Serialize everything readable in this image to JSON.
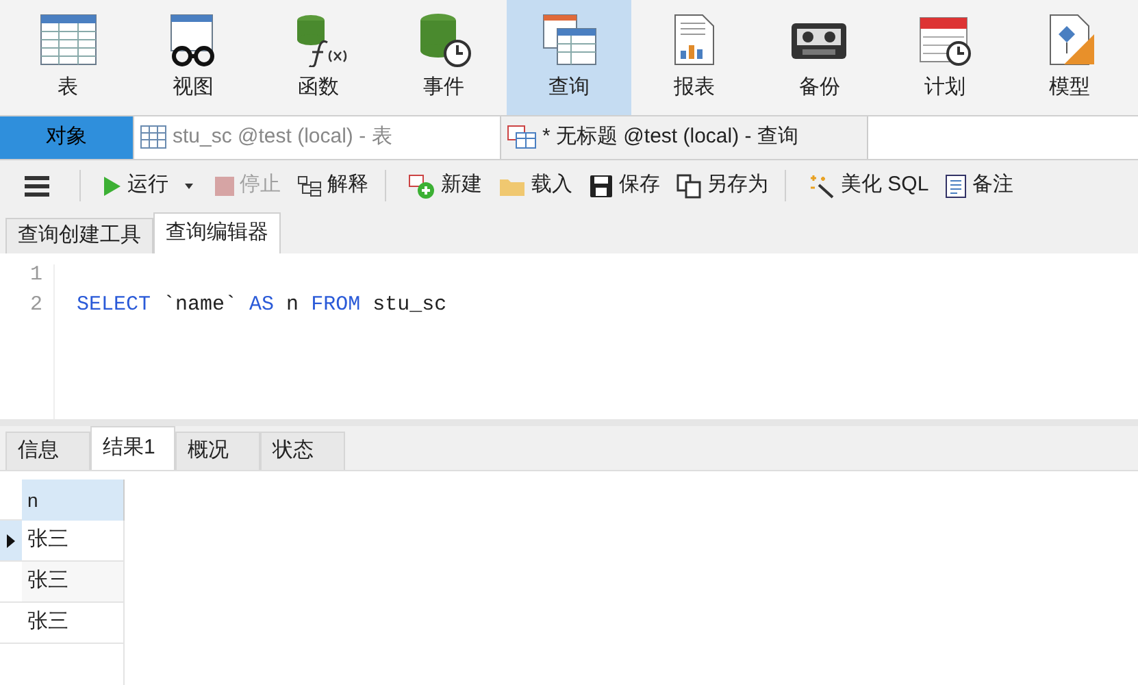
{
  "ribbon": [
    {
      "label": "表",
      "selected": false
    },
    {
      "label": "视图",
      "selected": false
    },
    {
      "label": "函数",
      "selected": false
    },
    {
      "label": "事件",
      "selected": false
    },
    {
      "label": "查询",
      "selected": true
    },
    {
      "label": "报表",
      "selected": false
    },
    {
      "label": "备份",
      "selected": false
    },
    {
      "label": "计划",
      "selected": false
    },
    {
      "label": "模型",
      "selected": false
    }
  ],
  "doc_tabs": [
    {
      "label": "对象",
      "kind": "objects",
      "selected": false
    },
    {
      "label": "stu_sc @test (local) - 表",
      "kind": "table",
      "selected": false
    },
    {
      "label": "* 无标题 @test (local) - 查询",
      "kind": "query",
      "selected": true
    }
  ],
  "toolbar": [
    [
      {
        "label": "运行",
        "disabled": false,
        "dropdown": true
      },
      {
        "label": "停止",
        "disabled": true,
        "dropdown": false
      },
      {
        "label": "解释",
        "disabled": false,
        "dropdown": false
      }
    ],
    [
      {
        "label": "新建",
        "disabled": false,
        "dropdown": false
      },
      {
        "label": "载入",
        "disabled": false,
        "dropdown": false
      },
      {
        "label": "保存",
        "disabled": false,
        "dropdown": false
      },
      {
        "label": "另存为",
        "disabled": false,
        "dropdown": false
      }
    ],
    [
      {
        "label": "美化 SQL",
        "disabled": false,
        "dropdown": false
      },
      {
        "label": "备注",
        "disabled": false,
        "dropdown": false
      }
    ]
  ],
  "editor_tabs": [
    {
      "label": "查询创建工具",
      "selected": false
    },
    {
      "label": "查询编辑器",
      "selected": true
    }
  ],
  "editor": {
    "lines": [
      {
        "number": "1"
      },
      {
        "number": "2",
        "tokens": [
          {
            "text": "SELECT",
            "kind": "keyword"
          },
          {
            "text": " `name` ",
            "kind": "plain"
          },
          {
            "text": "AS",
            "kind": "keyword"
          },
          {
            "text": " n ",
            "kind": "plain"
          },
          {
            "text": "FROM",
            "kind": "keyword"
          },
          {
            "text": " stu_sc",
            "kind": "plain"
          }
        ]
      }
    ]
  },
  "result_tabs": [
    {
      "label": "信息",
      "selected": false
    },
    {
      "label": "结果1",
      "selected": true
    },
    {
      "label": "概况",
      "selected": false
    },
    {
      "label": "状态",
      "selected": false
    }
  ],
  "result_table": {
    "columns": [
      "n"
    ],
    "rows": [
      {
        "cells": [
          "张三"
        ],
        "selected": true
      },
      {
        "cells": [
          "张三"
        ],
        "selected": false
      },
      {
        "cells": [
          "张三"
        ],
        "selected": false
      }
    ]
  }
}
